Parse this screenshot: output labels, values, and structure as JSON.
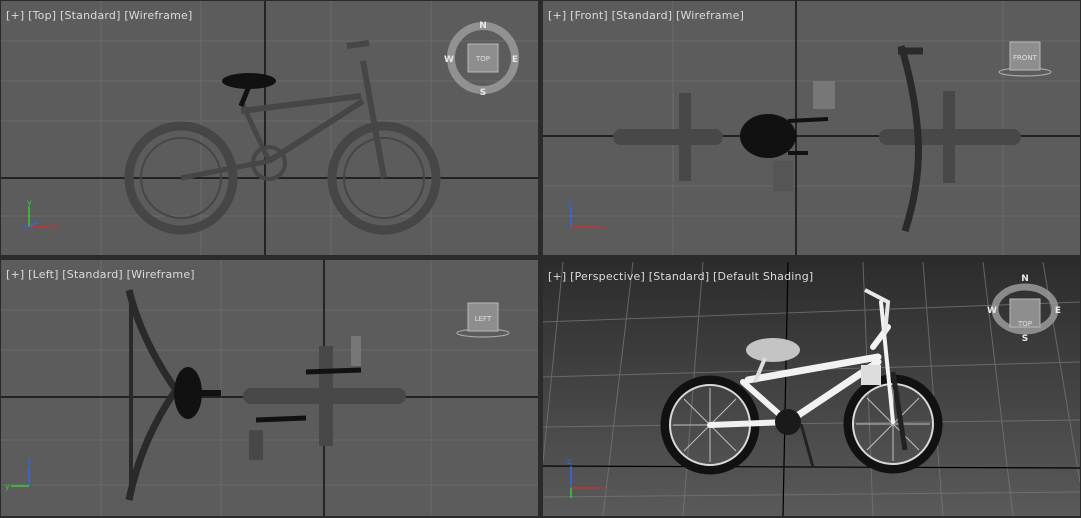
{
  "viewports": {
    "top": {
      "labels": [
        "[+]",
        "[Top]",
        "[Standard]",
        "[Wireframe]"
      ],
      "cube": "TOP",
      "compass": {
        "n": "N",
        "s": "S",
        "e": "E",
        "w": "W"
      },
      "axes": {
        "a": "y",
        "b": "z",
        "c": "x"
      }
    },
    "front": {
      "labels": [
        "[+]",
        "[Front]",
        "[Standard]",
        "[Wireframe]"
      ],
      "cube": "FRONT",
      "axes": {
        "a": "z",
        "b": "x"
      }
    },
    "left": {
      "labels": [
        "[+]",
        "[Left]",
        "[Standard]",
        "[Wireframe]"
      ],
      "cube": "LEFT",
      "axes": {
        "a": "z",
        "b": "y"
      }
    },
    "perspective": {
      "labels": [
        "[+]",
        "[Perspective]",
        "[Standard]",
        "[Default Shading]"
      ],
      "cube": "TOP",
      "compass": {
        "n": "N",
        "s": "S",
        "e": "E",
        "w": "W"
      },
      "axes": {
        "a": "z",
        "b": "x"
      }
    }
  },
  "colors": {
    "active_border": "#c8b26a",
    "viewport_bg": "#5a5a5a",
    "grid": "#6e6e6e",
    "axis_line": "#000000"
  }
}
